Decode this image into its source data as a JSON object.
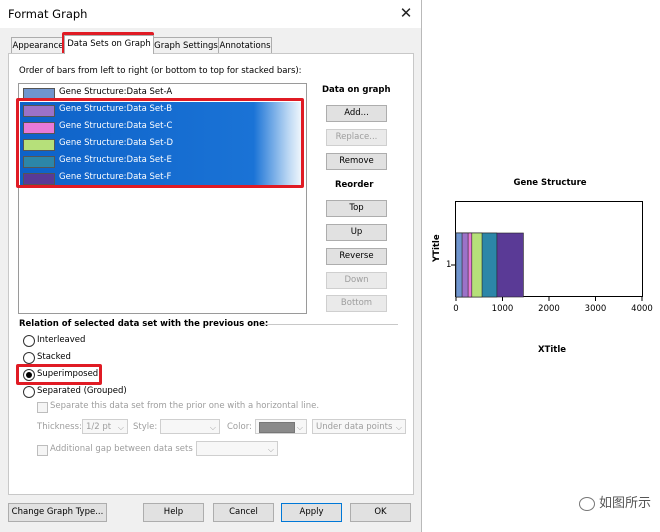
{
  "dialog": {
    "title": "Format Graph",
    "tabs": [
      "Appearance",
      "Data Sets on Graph",
      "Graph Settings",
      "Annotations"
    ],
    "active_tab": "Data Sets on Graph",
    "order_label": "Order of bars from left to right (or bottom to top for stacked bars):",
    "data_sets": [
      {
        "label": "Gene Structure:Data Set-A",
        "color": "#6f95cf",
        "selected": false
      },
      {
        "label": "Gene Structure:Data Set-B",
        "color": "#9c72c8",
        "selected": true
      },
      {
        "label": "Gene Structure:Data Set-C",
        "color": "#e87ad8",
        "selected": true
      },
      {
        "label": "Gene Structure:Data Set-D",
        "color": "#b6e07a",
        "selected": true
      },
      {
        "label": "Gene Structure:Data Set-E",
        "color": "#2c86a8",
        "selected": true
      },
      {
        "label": "Gene Structure:Data Set-F",
        "color": "#5a3a96",
        "selected": true
      }
    ],
    "data_on_graph": {
      "heading": "Data on graph",
      "add": "Add...",
      "replace": "Replace...",
      "remove": "Remove"
    },
    "reorder": {
      "heading": "Reorder",
      "top": "Top",
      "up": "Up",
      "reverse": "Reverse",
      "down": "Down",
      "bottom": "Bottom"
    },
    "relation": {
      "heading": "Relation of selected data set with the previous one:",
      "options": [
        "Interleaved",
        "Stacked",
        "Superimposed",
        "Separated (Grouped)"
      ],
      "selected": "Superimposed",
      "separate_line": "Separate this data set from the prior one with a horizontal line.",
      "thickness_label": "Thickness:",
      "thickness_value": "1/2 pt",
      "style_label": "Style:",
      "color_label": "Color:",
      "position_value": "Under data points",
      "additional_gap": "Additional gap between data sets"
    },
    "footer": {
      "change_type": "Change Graph Type...",
      "help": "Help",
      "cancel": "Cancel",
      "apply": "Apply",
      "ok": "OK"
    }
  },
  "chart_data": {
    "type": "bar",
    "orientation": "horizontal",
    "title": "Gene Structure",
    "xlabel": "XTitle",
    "ylabel": "YTitle",
    "categories": [
      "1"
    ],
    "xlim": [
      0,
      4000
    ],
    "xticks": [
      0,
      1000,
      2000,
      3000,
      4000
    ],
    "relation": "superimposed",
    "series": [
      {
        "name": "Data Set-F",
        "values": [
          1450
        ],
        "color": "#5a3a96"
      },
      {
        "name": "Data Set-E",
        "values": [
          880
        ],
        "color": "#2c86a8"
      },
      {
        "name": "Data Set-D",
        "values": [
          560
        ],
        "color": "#b6e07a"
      },
      {
        "name": "Data Set-C",
        "values": [
          340
        ],
        "color": "#e87ad8"
      },
      {
        "name": "Data Set-B",
        "values": [
          260
        ],
        "color": "#9c72c8"
      },
      {
        "name": "Data Set-A",
        "values": [
          130
        ],
        "color": "#6f95cf"
      }
    ]
  },
  "watermark": "如图所示",
  "icons": {
    "close": "close-icon",
    "wechat": "wechat-icon",
    "dropdown": "chevron-down-icon"
  }
}
